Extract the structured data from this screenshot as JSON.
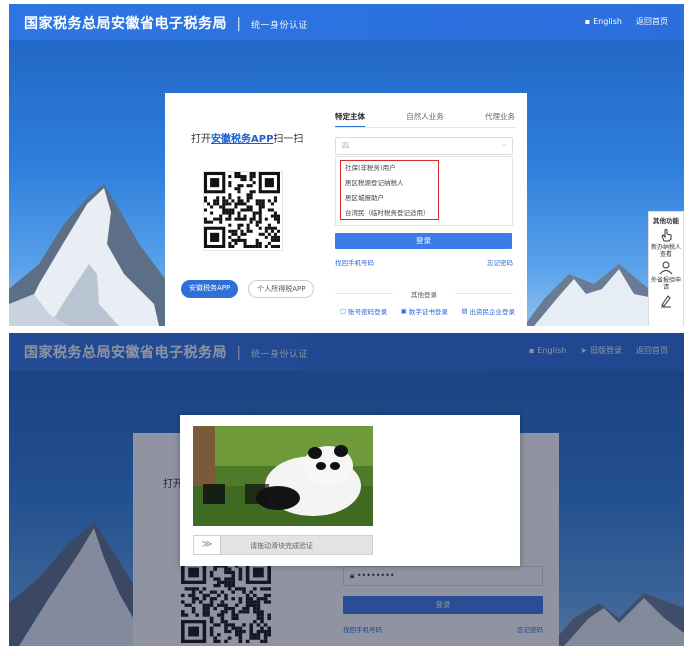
{
  "header": {
    "site_title": "国家税务总局安徽省电子税务局",
    "separator": "|",
    "subtitle": "统一身份认证",
    "english_link": "English",
    "elder_link": "旧版登录",
    "home_link": "返回首页"
  },
  "qr_panel": {
    "prefix": "打开",
    "app_name": "安徽税务APP",
    "suffix": "扫一扫",
    "app_buttons": [
      "安徽税务APP",
      "个人所得税APP"
    ]
  },
  "login": {
    "tabs": [
      "特定主体",
      "自然人业务",
      "代理业务"
    ],
    "select_placeholder": "四",
    "dropdown_options": [
      "社保(非税务)用户",
      "居区税源登记纳税人",
      "居区城报助户",
      "台湾民（临时税务登记适用）"
    ],
    "login_button": "登录",
    "forgot_phone": "找回手机号码",
    "forgot_password": "忘记密码",
    "other_login_title": "其他登录",
    "other_options": [
      "账号密码登录",
      "数字证书登录",
      "出资民企业登录"
    ],
    "password_mask": "••••••••"
  },
  "side_float": {
    "title": "其他功能",
    "items": [
      "新办纳税人查看",
      "外省报验申请",
      ""
    ]
  },
  "captcha": {
    "slider_text": "请拖动滑块完成验证",
    "handle_glyph": "≫"
  },
  "colors": {
    "brand_blue": "#2d75e2",
    "highlight_red": "#d62a2a",
    "button_blue": "#3c7ce6"
  }
}
